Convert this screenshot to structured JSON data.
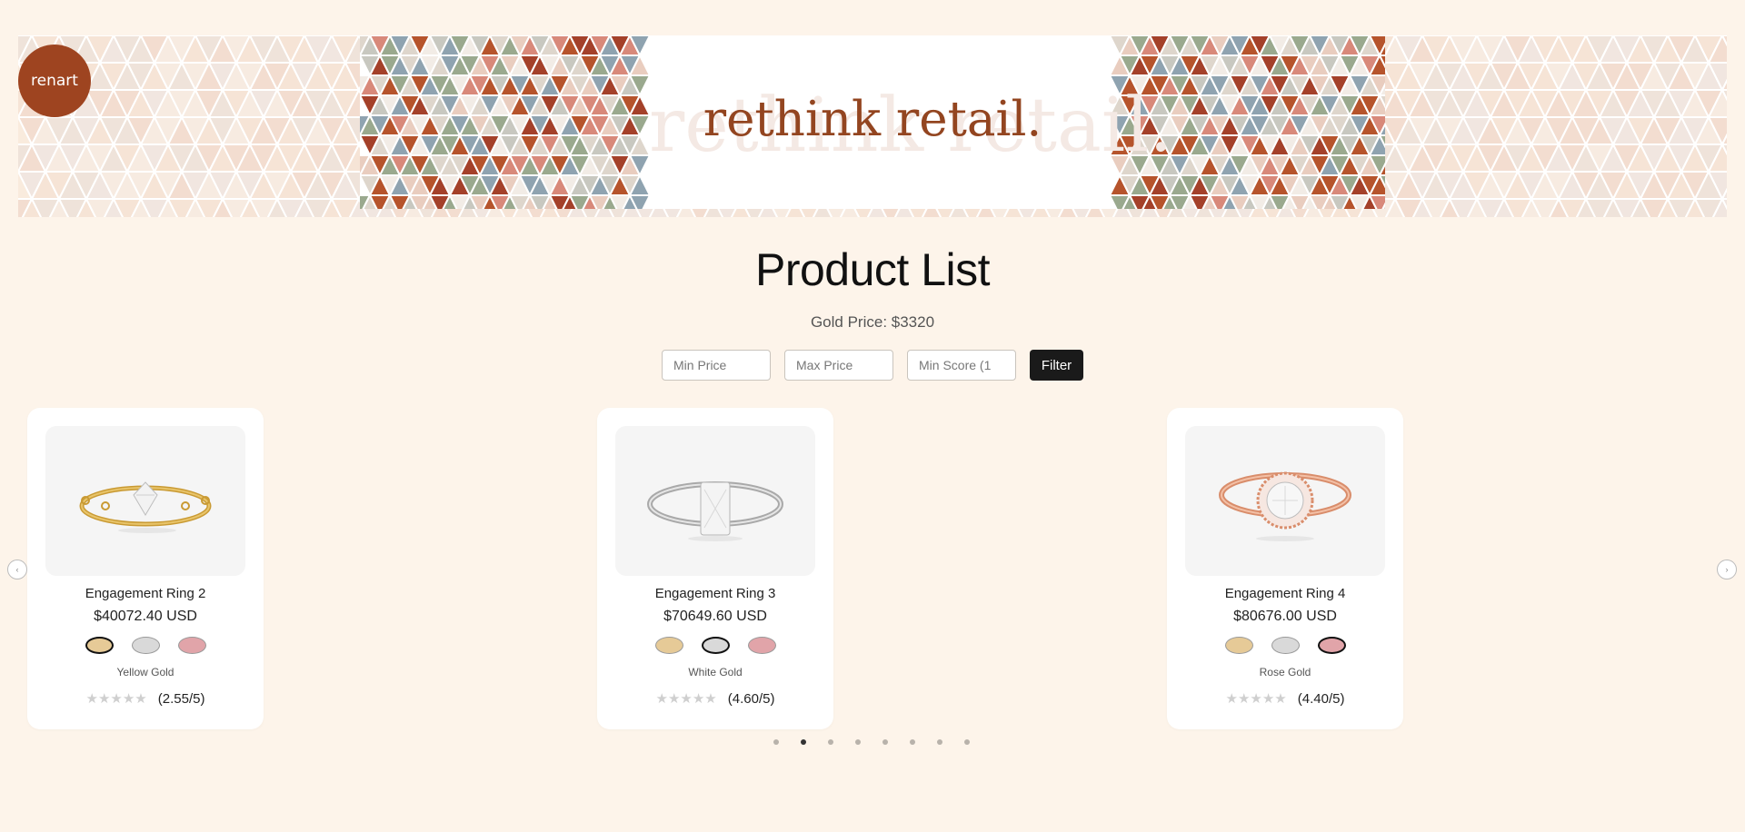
{
  "logo": {
    "text": "renart"
  },
  "banner": {
    "text": "rethink retail.",
    "ghost_text": "rethink retail."
  },
  "page": {
    "title": "Product List",
    "gold_price": "Gold Price: $3320"
  },
  "filters": {
    "min_price_placeholder": "Min Price",
    "max_price_placeholder": "Max Price",
    "min_score_placeholder": "Min Score (1",
    "button_label": "Filter"
  },
  "colors": {
    "accent": "#9e4420",
    "yellow_gold": "#e6ca97",
    "white_gold": "#d9d9d9",
    "rose_gold": "#e1a4a9"
  },
  "products": [
    {
      "name": "Engagement Ring 2",
      "price": "$40072.40 USD",
      "metal": "Yellow Gold",
      "selected": 0,
      "stars": "★★★★★",
      "score": "(2.55/5)",
      "rating": 2.55
    },
    {
      "name": "Engagement Ring 3",
      "price": "$70649.60 USD",
      "metal": "White Gold",
      "selected": 1,
      "stars": "★★★★★",
      "score": "(4.60/5)",
      "rating": 4.6
    },
    {
      "name": "Engagement Ring 4",
      "price": "$80676.00 USD",
      "metal": "Rose Gold",
      "selected": 2,
      "stars": "★★★★★",
      "score": "(4.40/5)",
      "rating": 4.4
    }
  ],
  "carousel": {
    "prev_icon": "‹",
    "next_icon": "›",
    "pages": 8,
    "active_page": 2
  }
}
